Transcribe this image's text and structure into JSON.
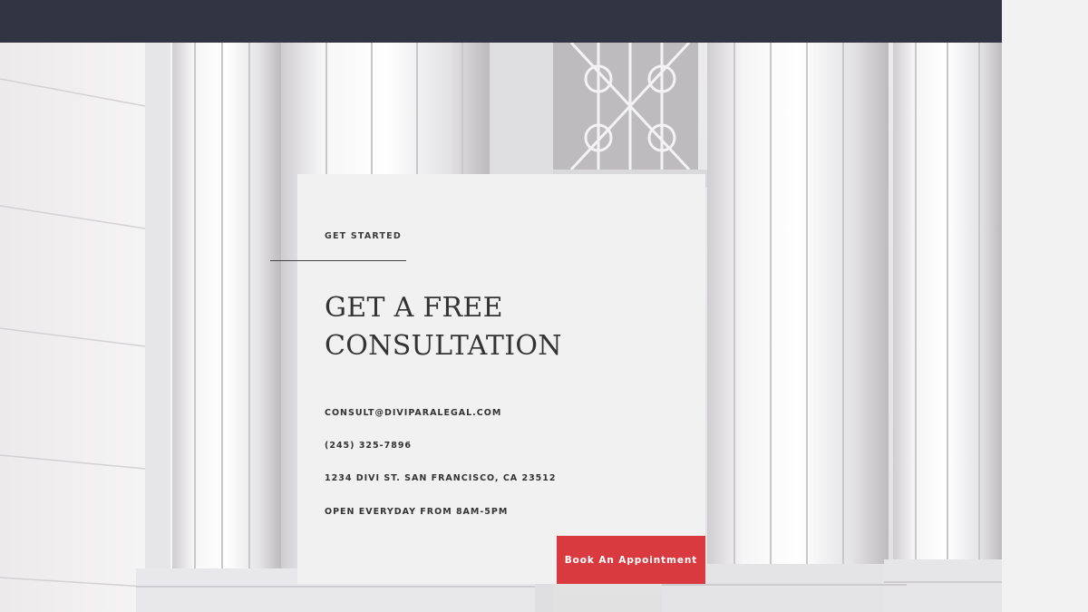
{
  "colors": {
    "topbar": "#313442",
    "accent": "#d93a40",
    "card_bg": "#f2f1f2",
    "text": "#333333"
  },
  "hero": {
    "background_image": "courthouse-columns-photo"
  },
  "card": {
    "eyebrow": "GET STARTED",
    "headline_line1": "GET A FREE",
    "headline_line2": "CONSULTATION",
    "email": "CONSULT@DIVIPARALEGAL.COM",
    "phone": "(245) 325-7896",
    "address": "1234 DIVI ST. SAN FRANCISCO, CA 23512",
    "hours": "OPEN EVERYDAY FROM 8AM-5PM",
    "cta_label": "Book An Appointment"
  }
}
